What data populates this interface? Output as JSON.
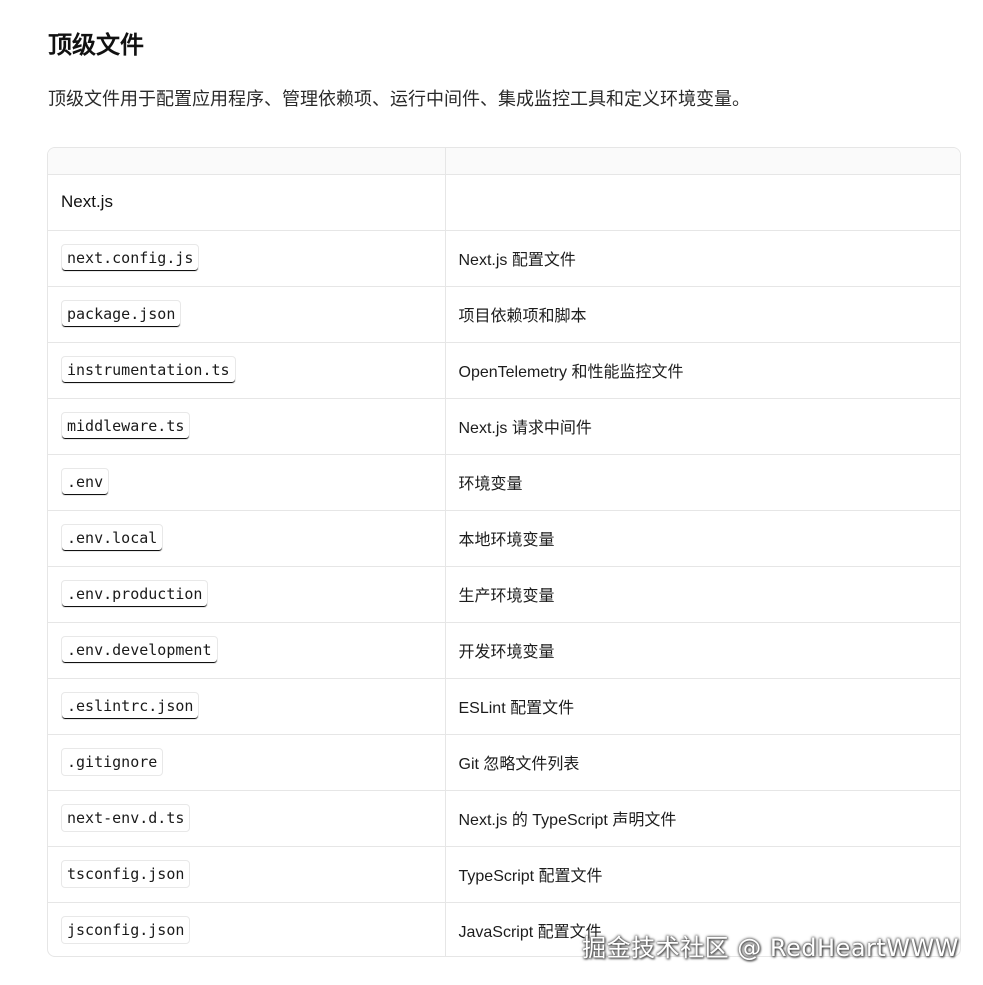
{
  "section": {
    "title": "顶级文件",
    "intro": "顶级文件用于配置应用程序、管理依赖项、运行中间件、集成监控工具和定义环境变量。"
  },
  "table": {
    "group_label": "Next.js",
    "rows": [
      {
        "file": "next.config.js",
        "desc": "Next.js 配置文件"
      },
      {
        "file": "package.json",
        "desc": "项目依赖项和脚本"
      },
      {
        "file": "instrumentation.ts",
        "desc": "OpenTelemetry 和性能监控文件"
      },
      {
        "file": "middleware.ts",
        "desc": "Next.js 请求中间件"
      },
      {
        "file": ".env",
        "desc": "环境变量"
      },
      {
        "file": ".env.local",
        "desc": "本地环境变量"
      },
      {
        "file": ".env.production",
        "desc": "生产环境变量"
      },
      {
        "file": ".env.development",
        "desc": "开发环境变量"
      },
      {
        "file": ".eslintrc.json",
        "desc": "ESLint 配置文件"
      },
      {
        "file": ".gitignore",
        "desc": "Git 忽略文件列表"
      },
      {
        "file": "next-env.d.ts",
        "desc": "Next.js 的 TypeScript 声明文件"
      },
      {
        "file": "tsconfig.json",
        "desc": "TypeScript 配置文件"
      },
      {
        "file": "jsconfig.json",
        "desc": "JavaScript 配置文件"
      }
    ]
  },
  "watermark": "掘金技术社区 @ RedHeartWWW"
}
